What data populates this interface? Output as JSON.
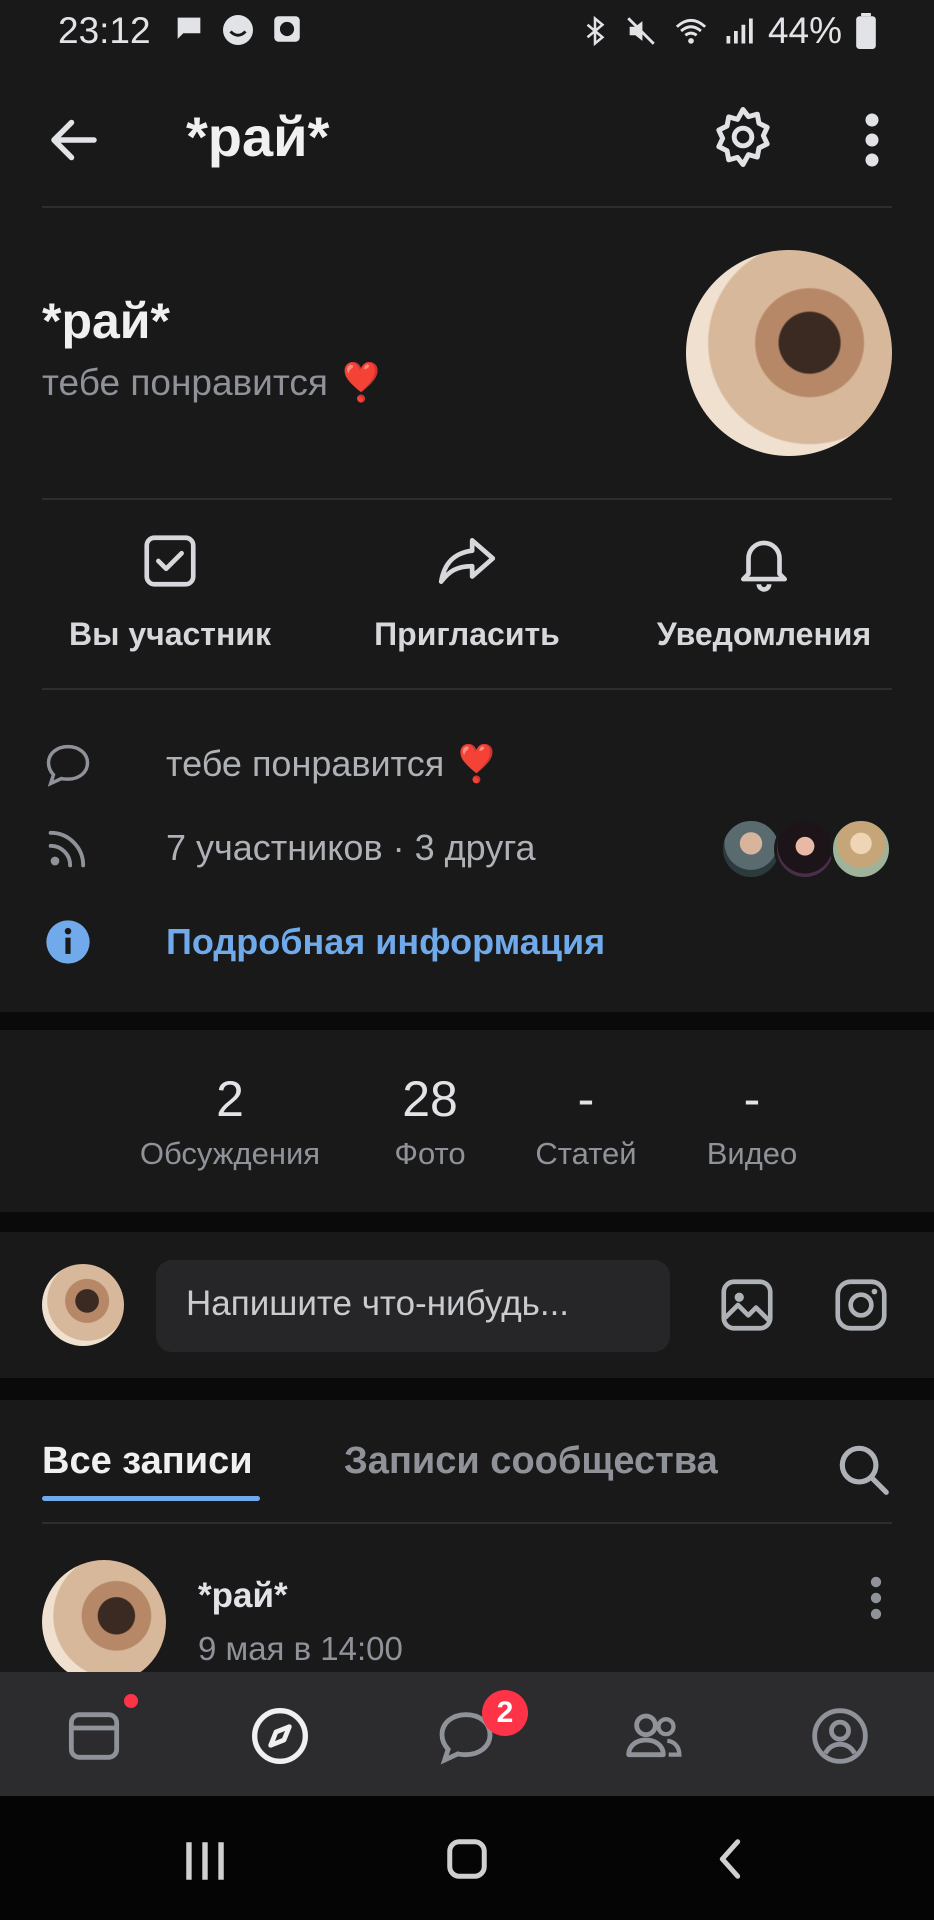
{
  "statusbar": {
    "time": "23:12",
    "battery": "44%"
  },
  "header": {
    "title": "*рай*"
  },
  "profile": {
    "name": "*рай*",
    "status": "тебе понравится ❣️"
  },
  "actions": [
    {
      "label": "Вы участник",
      "icon": "check-square-icon"
    },
    {
      "label": "Пригласить",
      "icon": "share-arrow-icon"
    },
    {
      "label": "Уведомления",
      "icon": "bell-icon"
    }
  ],
  "info": {
    "description": "тебе понравится ❣️",
    "members": "7 участников · 3 друга",
    "more_link": "Подробная информация"
  },
  "counters": [
    {
      "num": "2",
      "cap": "Обсуждения"
    },
    {
      "num": "28",
      "cap": "Фото"
    },
    {
      "num": "-",
      "cap": "Статей"
    },
    {
      "num": "-",
      "cap": "Видео"
    }
  ],
  "compose": {
    "placeholder": "Напишите что-нибудь..."
  },
  "wall": {
    "tab_all": "Все записи",
    "tab_community": "Записи сообщества",
    "post": {
      "author": "*рай*",
      "date": "9 мая в 14:00"
    }
  },
  "tabbar": {
    "messages_badge": "2"
  },
  "colors": {
    "accent": "#71aaeb",
    "badge": "#ff3347",
    "background": "#19191a"
  }
}
